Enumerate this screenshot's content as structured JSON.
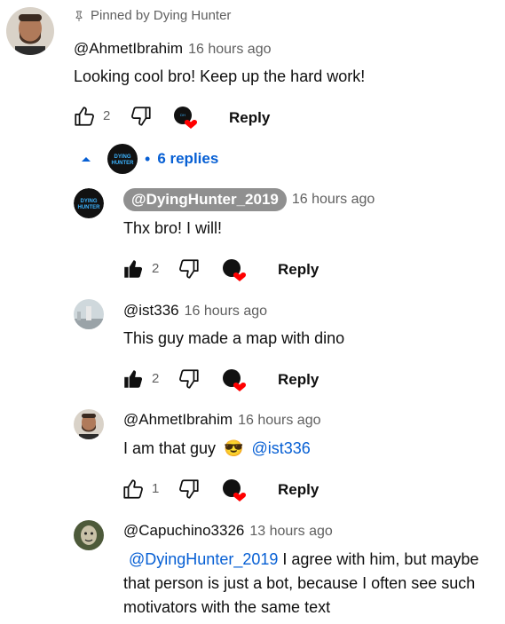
{
  "pinned": {
    "label": "Pinned by Dying Hunter"
  },
  "comments": [
    {
      "handle": "@AhmetIbrahim",
      "time": "16 hours ago",
      "text": "Looking cool bro! Keep up the hard work!",
      "likes": "2",
      "reply_label": "Reply"
    },
    {
      "handle": "@DyingHunter_2019",
      "time": "16 hours ago",
      "text": "Thx bro! I will!",
      "likes": "2",
      "reply_label": "Reply"
    },
    {
      "handle": "@ist336",
      "time": "16 hours ago",
      "text": "This guy made a map with dino",
      "likes": "2",
      "reply_label": "Reply"
    },
    {
      "handle": "@AhmetIbrahim",
      "time": "16 hours ago",
      "text": "I am that guy",
      "emoji": "😎",
      "mention": "@ist336",
      "likes": "1",
      "reply_label": "Reply"
    },
    {
      "handle": "@Capuchino3326",
      "time": "13 hours ago",
      "mention": "@DyingHunter_2019",
      "text_line1": " I agree with him, but maybe",
      "text_line2": "that person is just a bot, because I often see such",
      "text_line3": "motivators with the same text"
    }
  ],
  "replies_toggle": {
    "dot": "•",
    "label": "6 replies"
  },
  "channel_avatar": {
    "text_top": "DYING",
    "text_bottom": "HUNTER"
  },
  "colors": {
    "link": "#065fd4",
    "heart": "#ff0000",
    "owner_pill": "#909090"
  }
}
